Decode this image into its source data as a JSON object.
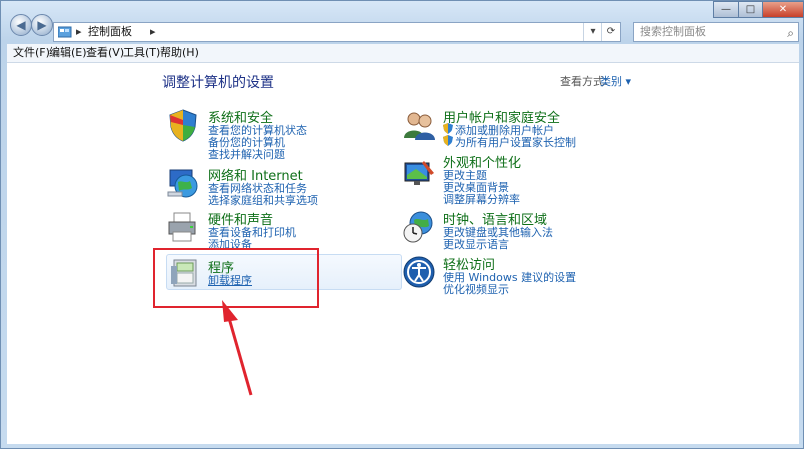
{
  "titlebar": {
    "back_glyph": "◀",
    "forward_glyph": "▶",
    "address_crumbs": [
      "控制面板",
      "▸"
    ],
    "address_separator": "▸",
    "address_dropdown": "▾",
    "refresh_glyph": "⟳",
    "search_placeholder": "搜索控制面板",
    "window_controls": [
      "—",
      "□",
      "✕"
    ]
  },
  "menu": [
    "文件(F)",
    "编辑(E)",
    "查看(V)",
    "工具(T)",
    "帮助(H)"
  ],
  "page": {
    "heading": "调整计算机的设置",
    "view_by_label": "查看方式:",
    "view_by_value": "类别 ▾"
  },
  "categories": {
    "system": {
      "title": "系统和安全",
      "links": [
        "查看您的计算机状态",
        "备份您的计算机",
        "查找并解决问题"
      ]
    },
    "network": {
      "title": "网络和 Internet",
      "links": [
        "查看网络状态和任务",
        "选择家庭组和共享选项"
      ]
    },
    "hardware": {
      "title": "硬件和声音",
      "links": [
        "查看设备和打印机",
        "添加设备"
      ]
    },
    "programs": {
      "title": "程序",
      "links": [
        "卸载程序"
      ]
    },
    "users": {
      "title": "用户帐户和家庭安全",
      "links": [
        "添加或删除用户帐户",
        "为所有用户设置家长控制"
      ]
    },
    "appearance": {
      "title": "外观和个性化",
      "links": [
        "更改主题",
        "更改桌面背景",
        "调整屏幕分辨率"
      ]
    },
    "clock": {
      "title": "时钟、语言和区域",
      "links": [
        "更改键盘或其他输入法",
        "更改显示语言"
      ]
    },
    "ease": {
      "title": "轻松访问",
      "links": [
        "使用 Windows 建议的设置",
        "优化视频显示"
      ]
    }
  },
  "icons": [
    "shield-icon",
    "globe-network-icon",
    "printer-icon",
    "programs-box-icon",
    "users-icon",
    "monitor-paint-icon",
    "clock-globe-icon",
    "ease-of-access-icon",
    "uac-shield-icon"
  ],
  "colors": {
    "heading": "#1e3287",
    "category_title": "#0e6f18",
    "link": "#1e62b0",
    "highlight_annotation": "#e0242e"
  }
}
